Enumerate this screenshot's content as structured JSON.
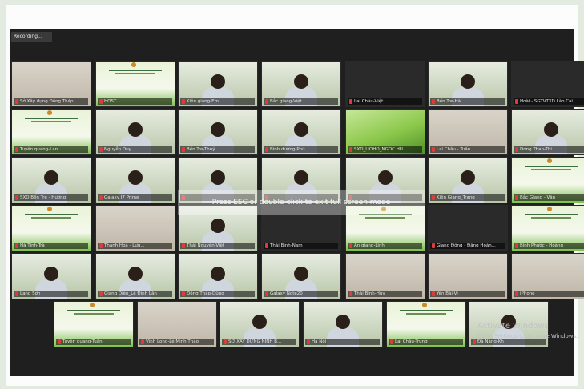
{
  "recording_label": "Recording...",
  "overlay_message": "Press ESC or double-click to exit full screen mode",
  "windows_watermark": {
    "title": "Activate Windows",
    "subtitle": "Go to Settings to activate Windows."
  },
  "participants": [
    {
      "name": "Sở Xây dựng Đồng Tháp",
      "kind": "room"
    },
    {
      "name": "HOST",
      "kind": "slide"
    },
    {
      "name": "Kiên giang-Em",
      "kind": "person"
    },
    {
      "name": "Bắc giang-Việt",
      "kind": "person"
    },
    {
      "name": "Lai Châu-Việt",
      "kind": "dark"
    },
    {
      "name": "Bến Tre-Hà",
      "kind": "person"
    },
    {
      "name": "Hoài - SGTVTXD Lào Cai",
      "kind": "dark"
    },
    {
      "name": "Tuyên quang-Lan",
      "kind": "slide"
    },
    {
      "name": "Nguyễn Duy",
      "kind": "person"
    },
    {
      "name": "Bến Tre-Thuỷ",
      "kind": "person"
    },
    {
      "name": "Bình dương-Phú",
      "kind": "person"
    },
    {
      "name": "SXD_LIOHO_NGOC HU...",
      "kind": "grass"
    },
    {
      "name": "Lai Châu - Tuấn",
      "kind": "room"
    },
    {
      "name": "Dong Thap-Thi",
      "kind": "person"
    },
    {
      "name": "SXD Bến Tre - Hương",
      "kind": "person"
    },
    {
      "name": "Galaxy J7 Prime",
      "kind": "person"
    },
    {
      "name": "",
      "kind": "person"
    },
    {
      "name": "",
      "kind": "person"
    },
    {
      "name": "",
      "kind": "person"
    },
    {
      "name": "Kiên Giang_Trang",
      "kind": "person"
    },
    {
      "name": "Bắc Giang - Văn",
      "kind": "slide"
    },
    {
      "name": "Hà Tĩnh-Trà",
      "kind": "slide"
    },
    {
      "name": "Thanh Hoá - Lưu...",
      "kind": "room"
    },
    {
      "name": "Thái Nguyên-Việt",
      "kind": "person"
    },
    {
      "name": "Thái Bình-Nam",
      "kind": "dark"
    },
    {
      "name": "An giang-Linh",
      "kind": "slide"
    },
    {
      "name": "Giang Đông - Đặng Hoàn...",
      "kind": "dark"
    },
    {
      "name": "Bình Phước - Hoàng",
      "kind": "slide"
    },
    {
      "name": "Lạng Sơn",
      "kind": "person"
    },
    {
      "name": "Giang Diên_Lê Đình Lân",
      "kind": "person"
    },
    {
      "name": "Đồng Tháp-Dũng",
      "kind": "person"
    },
    {
      "name": "Galaxy Note20",
      "kind": "person"
    },
    {
      "name": "Thái Bình-Huy",
      "kind": "room"
    },
    {
      "name": "Yên Bái-Vi",
      "kind": "room"
    },
    {
      "name": "iPhone",
      "kind": "room"
    },
    {
      "name": "Tuyên quang-Tuấn",
      "kind": "slide"
    },
    {
      "name": "Vĩnh Long-Lê Minh Thảo",
      "kind": "room"
    },
    {
      "name": "SỞ XÂY DỰNG NINH B...",
      "kind": "person"
    },
    {
      "name": "Hà Nội",
      "kind": "person"
    },
    {
      "name": "Lai Châu-Trung",
      "kind": "slide"
    },
    {
      "name": "Đà Nẵng-Kh",
      "kind": "person"
    }
  ],
  "colors": {
    "slide_bg": "#eaf3d8",
    "slide_green": "#7fbf4f",
    "dark": "#2a2a2a",
    "room": "#bfb7a8",
    "grass": "#8cc84b"
  }
}
